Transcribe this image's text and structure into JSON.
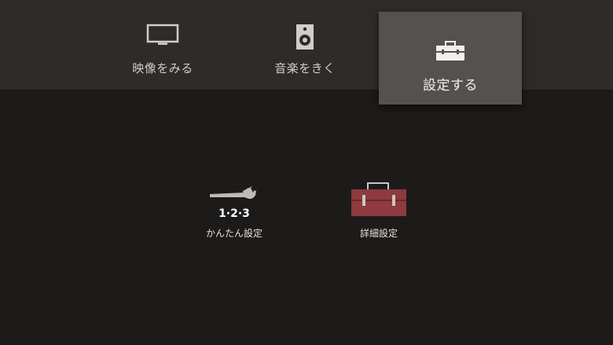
{
  "tabs": [
    {
      "label": "映像をみる",
      "icon": "tv-icon"
    },
    {
      "label": "音楽をきく",
      "icon": "speaker-icon"
    },
    {
      "label": "設定する",
      "icon": "toolbox-icon",
      "selected": true
    }
  ],
  "settings_items": [
    {
      "label": "かんたん設定",
      "icon": "wrench-123-icon",
      "icon_text": "1·2·3"
    },
    {
      "label": "詳細設定",
      "icon": "red-toolbox-icon"
    }
  ],
  "colors": {
    "background": "#1c1b1a",
    "topbar": "#2e2c2a",
    "selected_tab": "#55514e",
    "toolbox_red": "#8e3a3f"
  }
}
